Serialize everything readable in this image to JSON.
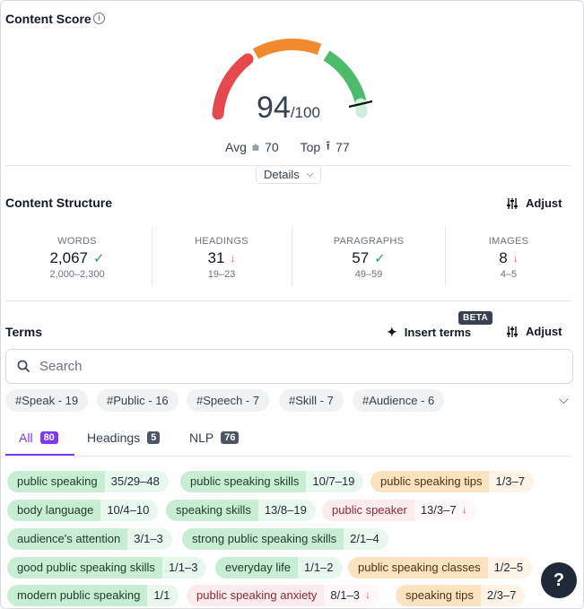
{
  "content_score": {
    "title": "Content Score",
    "info_icon": "info-icon",
    "score": "94",
    "out_of": "/100",
    "avg_label": "Avg",
    "avg_value": "70",
    "top_label": "Top",
    "top_value": "77",
    "details_label": "Details",
    "gauge_fraction": 0.94,
    "colors": {
      "red": "#e5484d",
      "orange": "#f08a2c",
      "green": "#4cbb6c",
      "track": "#cfeedd"
    }
  },
  "structure": {
    "title": "Content Structure",
    "adjust_label": "Adjust",
    "stats": [
      {
        "label": "WORDS",
        "value": "2,067",
        "status": "ok",
        "range": "2,000–2,300"
      },
      {
        "label": "HEADINGS",
        "value": "31",
        "status": "down",
        "range": "19–23"
      },
      {
        "label": "PARAGRAPHS",
        "value": "57",
        "status": "ok",
        "range": "49–59"
      },
      {
        "label": "IMAGES",
        "value": "8",
        "status": "down",
        "range": "4–5"
      }
    ]
  },
  "terms": {
    "title": "Terms",
    "insert_label": "Insert terms",
    "beta_label": "BETA",
    "adjust_label": "Adjust",
    "search_placeholder": "Search",
    "topics": [
      "#Speak - 19",
      "#Public - 16",
      "#Speech - 7",
      "#Skill - 7",
      "#Audience - 6"
    ],
    "tabs": [
      {
        "label": "All",
        "count": "80"
      },
      {
        "label": "Headings",
        "count": "5"
      },
      {
        "label": "NLP",
        "count": "76"
      }
    ],
    "items": [
      {
        "name": "public speaking",
        "range": "35/29–48",
        "status": "green",
        "arrow": ""
      },
      {
        "name": "public speaking skills",
        "range": "10/7–19",
        "status": "green",
        "arrow": ""
      },
      {
        "name": "public speaking tips",
        "range": "1/3–7",
        "status": "orange",
        "arrow": ""
      },
      {
        "name": "body language",
        "range": "10/4–10",
        "status": "green",
        "arrow": ""
      },
      {
        "name": "speaking skills",
        "range": "13/8–19",
        "status": "green",
        "arrow": ""
      },
      {
        "name": "public speaker",
        "range": "13/3–7",
        "status": "red",
        "arrow": "↓"
      },
      {
        "name": "audience's attention",
        "range": "3/1–3",
        "status": "green",
        "arrow": ""
      },
      {
        "name": "strong public speaking skills",
        "range": "2/1–4",
        "status": "green",
        "arrow": ""
      },
      {
        "name": "good public speaking skills",
        "range": "1/1–3",
        "status": "green",
        "arrow": ""
      },
      {
        "name": "everyday life",
        "range": "1/1–2",
        "status": "green",
        "arrow": ""
      },
      {
        "name": "public speaking classes",
        "range": "1/2–5",
        "status": "orange",
        "arrow": ""
      },
      {
        "name": "modern public speaking",
        "range": "1/1",
        "status": "green",
        "arrow": ""
      },
      {
        "name": "public speaking anxiety",
        "range": "8/1–3",
        "status": "red",
        "arrow": "↓"
      },
      {
        "name": "speaking tips",
        "range": "2/3–7",
        "status": "orange",
        "arrow": ""
      }
    ]
  },
  "help": {
    "label": "?"
  }
}
